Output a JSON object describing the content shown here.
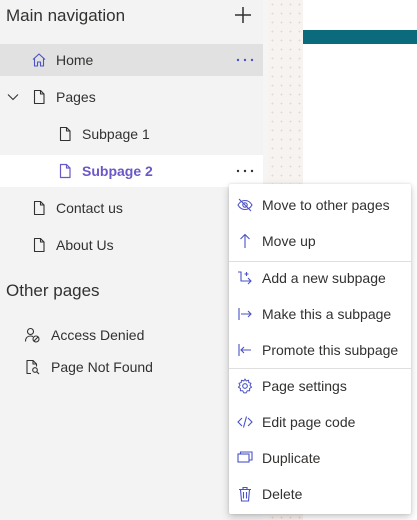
{
  "sidebar": {
    "title": "Main navigation",
    "items": [
      {
        "label": "Home"
      },
      {
        "label": "Pages"
      },
      {
        "label": "Subpage 1"
      },
      {
        "label": "Subpage 2"
      },
      {
        "label": "Contact us"
      },
      {
        "label": "About Us"
      }
    ]
  },
  "other_pages": {
    "title": "Other pages",
    "items": [
      {
        "label": "Access Denied"
      },
      {
        "label": "Page Not Found"
      }
    ]
  },
  "context_menu": {
    "items": [
      {
        "label": "Move to other pages",
        "icon": "hide-eye-icon"
      },
      {
        "label": "Move up",
        "icon": "arrow-up-icon"
      },
      {
        "label": "Add a new subpage",
        "icon": "add-subpage-icon"
      },
      {
        "label": "Make this a subpage",
        "icon": "indent-icon"
      },
      {
        "label": "Promote this subpage",
        "icon": "outdent-icon"
      },
      {
        "label": "Page settings",
        "icon": "gear-icon"
      },
      {
        "label": "Edit page code",
        "icon": "code-icon"
      },
      {
        "label": "Duplicate",
        "icon": "duplicate-icon"
      },
      {
        "label": "Delete",
        "icon": "trash-icon"
      }
    ]
  },
  "colors": {
    "accent": "#6b57c6",
    "selected_text": "#6b57c6",
    "hover_bg": "#e1e1e1",
    "banner": "#0b6a7c"
  }
}
